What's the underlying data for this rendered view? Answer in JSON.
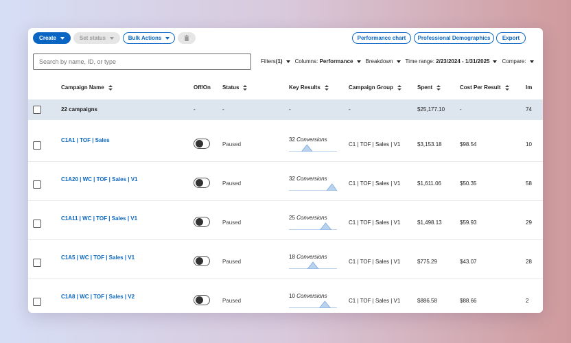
{
  "toolbar": {
    "create": "Create",
    "set_status": "Set status",
    "bulk_actions": "Bulk Actions",
    "performance_chart": "Performance chart",
    "professional_demographics": "Professional Demographics",
    "export": "Export"
  },
  "search": {
    "placeholder": "Search by name, ID, or type"
  },
  "filters": {
    "filters_label": "Filters",
    "filters_count": "(1)",
    "columns_label": "Columns:",
    "columns_value": "Performance",
    "breakdown": "Breakdown",
    "time_range_label": "Time range:",
    "time_range_value": "2/23/2024 - 1/31/2025",
    "compare": "Compare:"
  },
  "columns": {
    "campaign_name": "Campaign Name",
    "off_on": "Off/On",
    "status": "Status",
    "key_results": "Key Results",
    "campaign_group": "Campaign Group",
    "spent": "Spent",
    "cost_per_result": "Cost Per Result",
    "impressions": "Im"
  },
  "summary": {
    "name": "22 campaigns",
    "off_on": "-",
    "status": "-",
    "key_results": "-",
    "campaign_group": "-",
    "spent": "$25,177.10",
    "cost_per_result": "-",
    "impressions": "74"
  },
  "rows": [
    {
      "name": "C1A1 | TOF | Sales",
      "status": "Paused",
      "results_count": "32",
      "results_unit": "Conversions",
      "group": "C1 | TOF | Sales | V1",
      "spent": "$3,153.18",
      "cpr": "$98.54",
      "impressions": "10",
      "spark_peak": 0.35
    },
    {
      "name": "C1A20 | WC | TOF | Sales | V1",
      "status": "Paused",
      "results_count": "32",
      "results_unit": "Conversions",
      "group": "C1 | TOF | Sales | V1",
      "spent": "$1,611.06",
      "cpr": "$50.35",
      "impressions": "58",
      "spark_peak": 0.98
    },
    {
      "name": "C1A11 | WC | TOF | Sales | V1",
      "status": "Paused",
      "results_count": "25",
      "results_unit": "Conversions",
      "group": "C1 | TOF | Sales | V1",
      "spent": "$1,498.13",
      "cpr": "$59.93",
      "impressions": "29",
      "spark_peak": 0.82
    },
    {
      "name": "C1A5 | WC | TOF | Sales | V1",
      "status": "Paused",
      "results_count": "18",
      "results_unit": "Conversions",
      "group": "C1 | TOF | Sales | V1",
      "spent": "$775.29",
      "cpr": "$43.07",
      "impressions": "28",
      "spark_peak": 0.5
    },
    {
      "name": "C1A8 | WC | TOF | Sales | V2",
      "status": "Paused",
      "results_count": "10",
      "results_unit": "Conversions",
      "group": "C1 | TOF | Sales | V1",
      "spent": "$886.58",
      "cpr": "$88.66",
      "impressions": "2",
      "spark_peak": 0.8
    }
  ],
  "colors": {
    "brand": "#0a66c2",
    "summary_bg": "#dde6ee",
    "spark_fill": "#b9d3ee",
    "spark_line": "#7aa9dc"
  },
  "icons": {
    "delete": "trash-icon",
    "chat": "chat-icon"
  }
}
